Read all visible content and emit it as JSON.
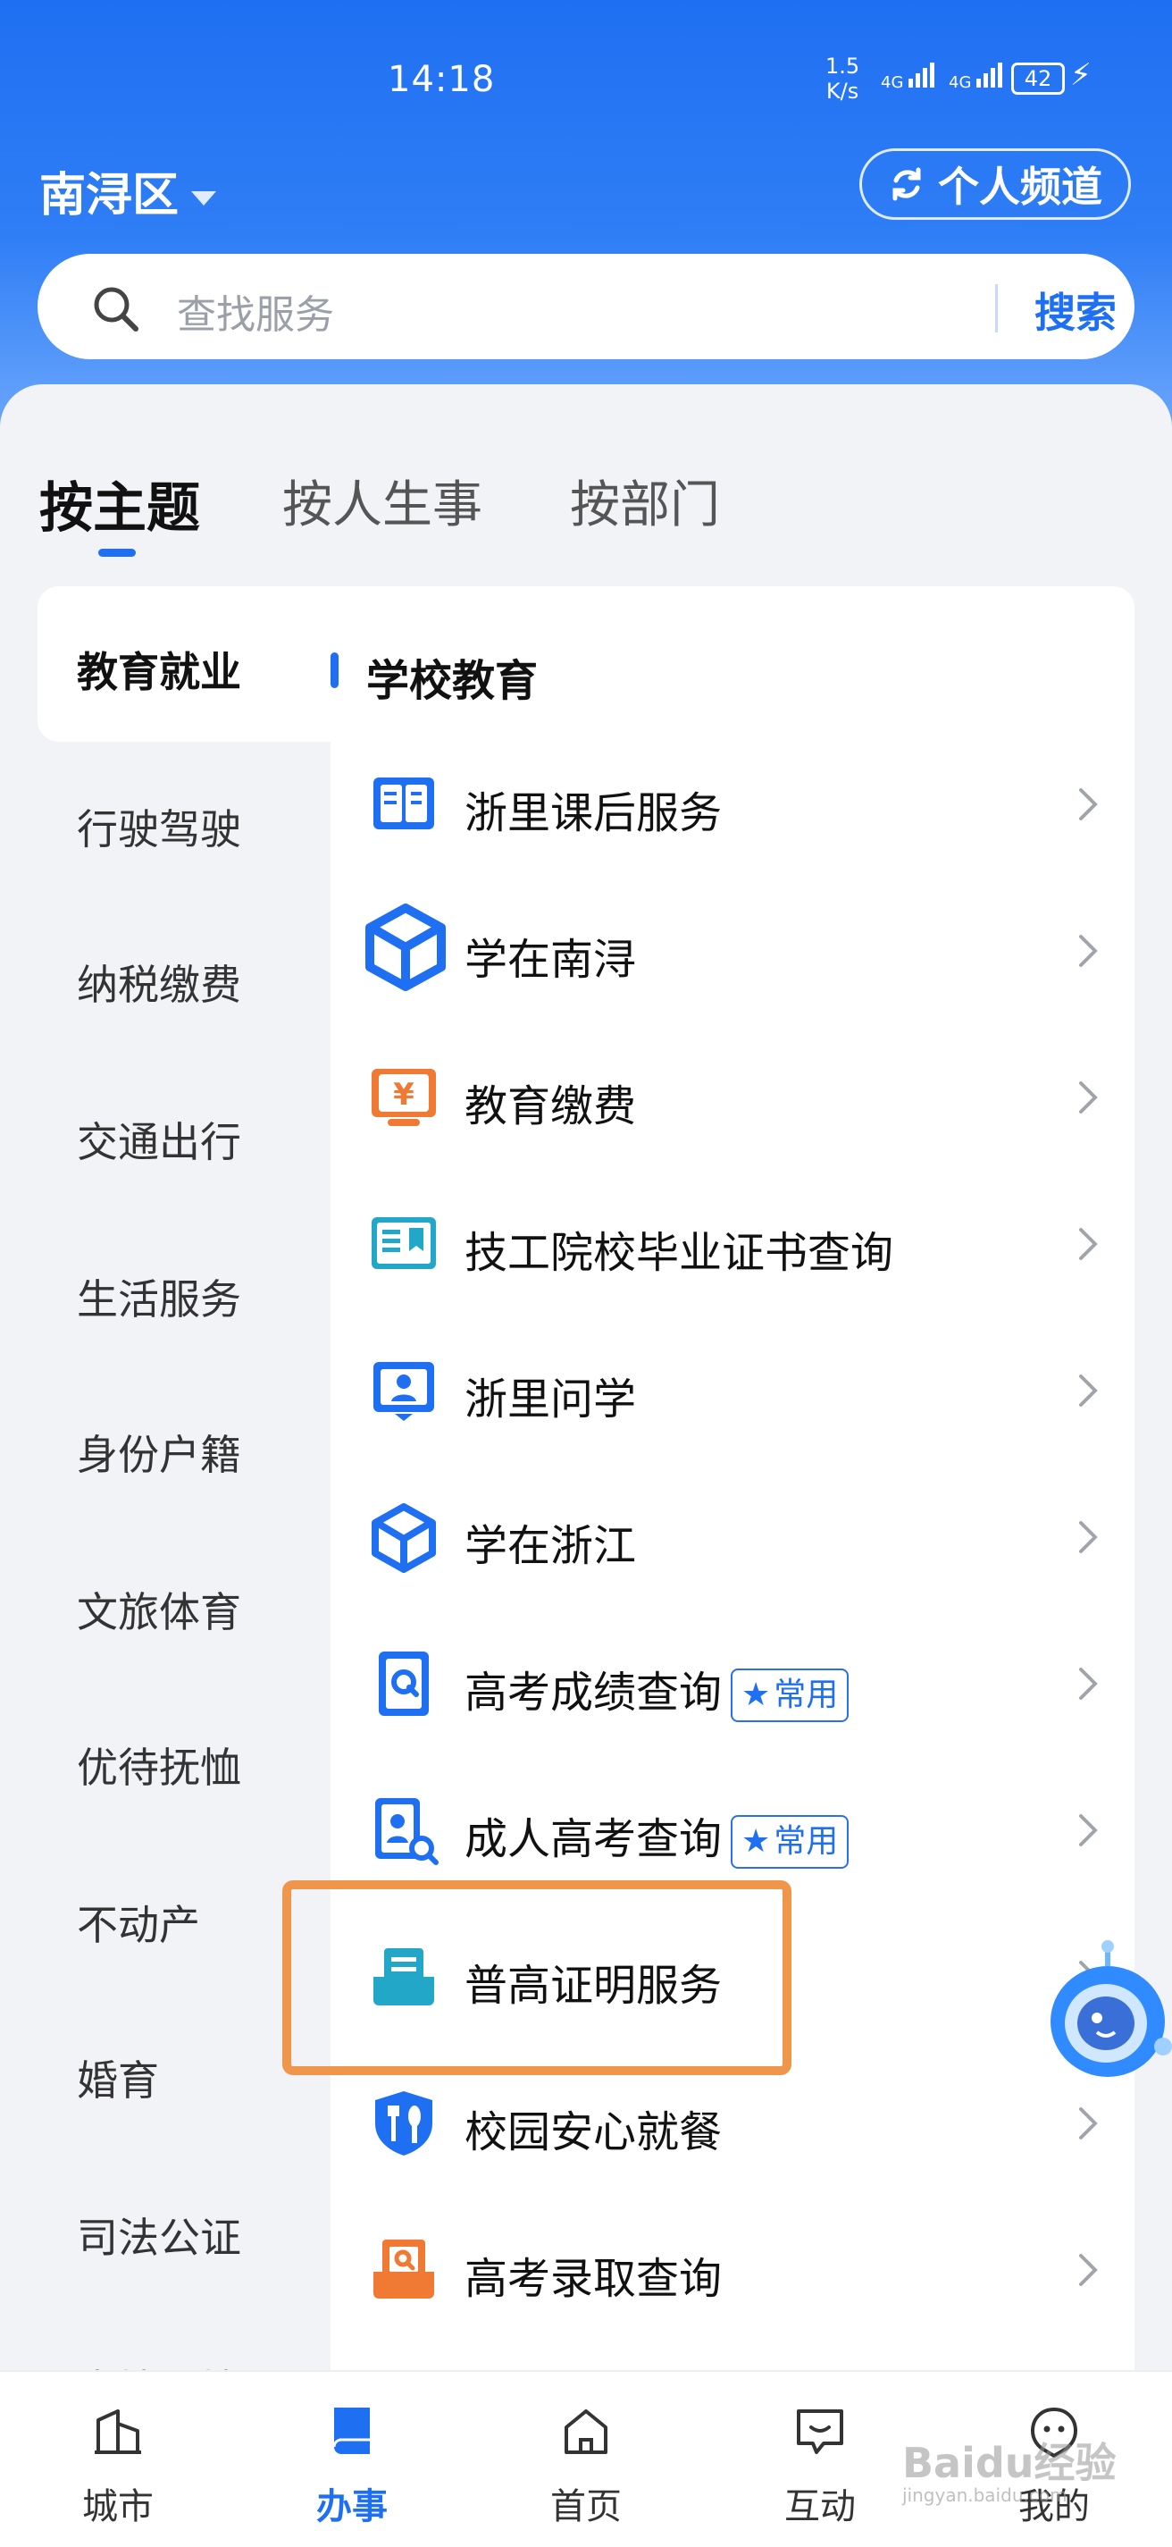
{
  "status_bar": {
    "time": "14:18",
    "net_speed": "1.5",
    "net_unit": "K/s",
    "sig1": "4G",
    "sig2": "4G",
    "battery": "42"
  },
  "header": {
    "region": "南浔区",
    "channel_label": "个人频道"
  },
  "search": {
    "placeholder": "查找服务",
    "button": "搜索"
  },
  "tabs": [
    "按主题",
    "按人生事",
    "按部门"
  ],
  "categories": [
    "教育就业",
    "行驶驾驶",
    "纳税缴费",
    "交通出行",
    "生活服务",
    "身份户籍",
    "文旅体育",
    "优待抚恤",
    "不动产",
    "婚育",
    "司法公证",
    "出境入境"
  ],
  "section": {
    "title": "学校教育"
  },
  "services": [
    {
      "label": "浙里课后服务",
      "icon": "book-icon"
    },
    {
      "label": "学在南浔",
      "icon": "cube-icon"
    },
    {
      "label": "教育缴费",
      "icon": "yuan-payment-icon"
    },
    {
      "label": "技工院校毕业证书查询",
      "icon": "certificate-icon"
    },
    {
      "label": "浙里问学",
      "icon": "student-icon"
    },
    {
      "label": "学在浙江",
      "icon": "cube-icon"
    },
    {
      "label": "高考成绩查询",
      "icon": "query-doc-icon",
      "badge": "常用"
    },
    {
      "label": "成人高考查询",
      "icon": "search-doc-icon",
      "badge": "常用"
    },
    {
      "label": "普高证明服务",
      "icon": "tray-doc-icon"
    },
    {
      "label": "校园安心就餐",
      "icon": "dining-shield-icon"
    },
    {
      "label": "高考录取查询",
      "icon": "admission-icon"
    }
  ],
  "bottom_nav": [
    {
      "label": "城市",
      "icon": "city-icon"
    },
    {
      "label": "办事",
      "icon": "affairs-icon"
    },
    {
      "label": "首页",
      "icon": "home-icon"
    },
    {
      "label": "互动",
      "icon": "chat-icon"
    },
    {
      "label": "我的",
      "icon": "profile-icon"
    }
  ],
  "watermark": {
    "text": "Baidu经验",
    "sub": "jingyan.baidu.com"
  },
  "colors": {
    "primary": "#1f6ff2",
    "highlight": "#f0964a",
    "orange_icon": "#f07a33",
    "teal_icon": "#22a7c8"
  }
}
